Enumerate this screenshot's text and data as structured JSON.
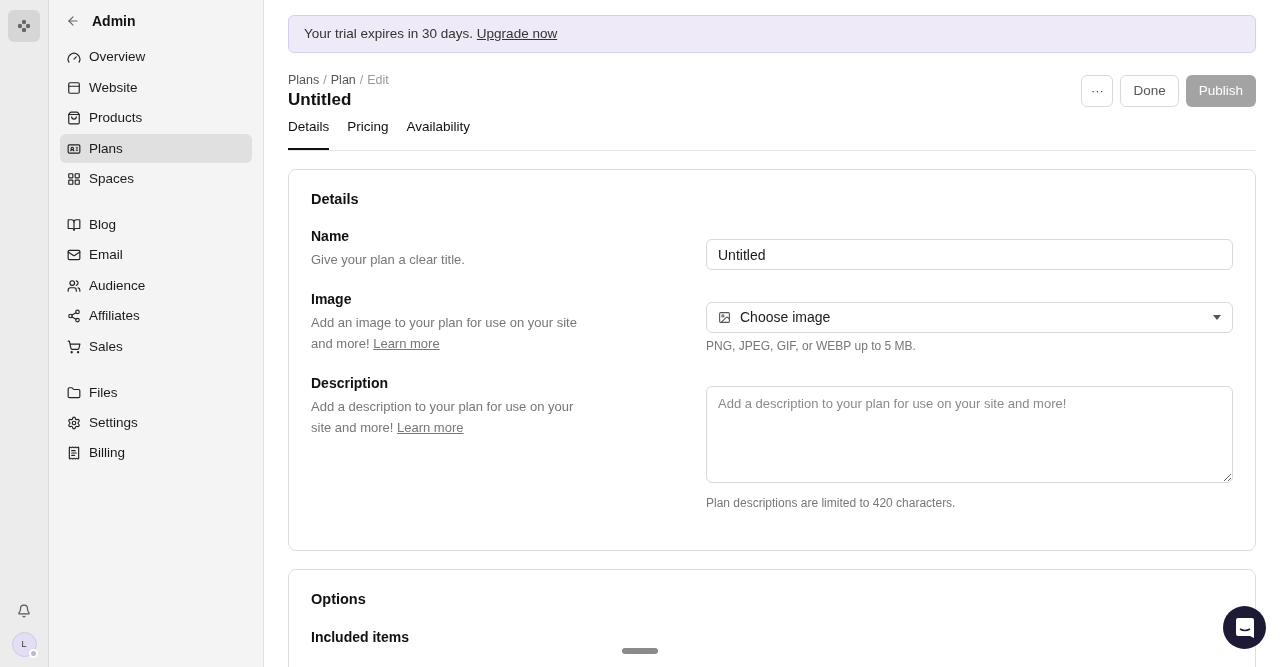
{
  "rail": {
    "avatar": "L",
    "online": false
  },
  "sidebar": {
    "title": "Admin",
    "groups": [
      [
        {
          "label": "Overview",
          "selected": false
        },
        {
          "label": "Website",
          "selected": false
        },
        {
          "label": "Products",
          "selected": false
        },
        {
          "label": "Plans",
          "selected": true
        },
        {
          "label": "Spaces",
          "selected": false
        }
      ],
      [
        {
          "label": "Blog",
          "selected": false
        },
        {
          "label": "Email",
          "selected": false
        },
        {
          "label": "Audience",
          "selected": false
        },
        {
          "label": "Affiliates",
          "selected": false
        },
        {
          "label": "Sales",
          "selected": false
        }
      ],
      [
        {
          "label": "Files",
          "selected": false
        },
        {
          "label": "Settings",
          "selected": false
        },
        {
          "label": "Billing",
          "selected": false
        }
      ]
    ]
  },
  "banner": {
    "text": "Your trial expires in 30 days.",
    "link": "Upgrade now"
  },
  "breadcrumb": {
    "items": [
      "Plans",
      "Plan",
      "Edit"
    ],
    "separators": [
      "/",
      "/"
    ]
  },
  "title": "Untitled",
  "actions": {
    "more": "···",
    "done": "Done",
    "publish": "Publish",
    "publish_disabled": true
  },
  "tabs": [
    {
      "label": "Details",
      "selected": true
    },
    {
      "label": "Pricing",
      "selected": false
    },
    {
      "label": "Availability",
      "selected": false
    }
  ],
  "details": {
    "heading": "Details",
    "fields": [
      {
        "kind": "text",
        "label": "Name",
        "help": "Give your plan a clear title.",
        "value": "Untitled"
      },
      {
        "kind": "image",
        "label": "Image",
        "help": "Add an image to your plan for use on your site and more!",
        "link": "Learn more",
        "value": "Choose image",
        "note": "PNG, JPEG, GIF, or WEBP up to 5 MB."
      },
      {
        "kind": "textarea",
        "label": "Description",
        "help": "Add a description to your plan for use on your site and more!",
        "link": "Learn more",
        "placeholder": "Add a description to your plan for use on your site and more!",
        "note": "Plan descriptions are limited to 420 characters."
      }
    ]
  },
  "options": {
    "heading": "Options",
    "first_label": "Included items"
  }
}
